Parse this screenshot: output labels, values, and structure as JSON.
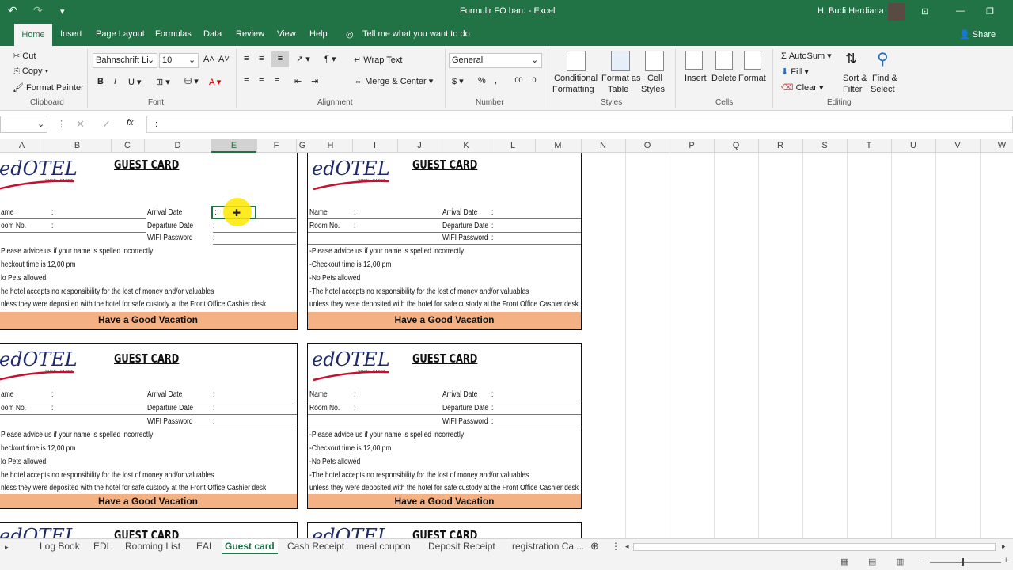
{
  "titlebar": {
    "doc_title": "Formulir FO baru  -  Excel",
    "user": "H. Budi Herdiana"
  },
  "menu": {
    "tabs": [
      "Home",
      "Insert",
      "Page Layout",
      "Formulas",
      "Data",
      "Review",
      "View",
      "Help"
    ],
    "tell_me": "Tell me what you want to do",
    "share": "Share"
  },
  "ribbon": {
    "clipboard": {
      "cut": "Cut",
      "copy": "Copy",
      "format_painter": "Format Painter",
      "label": "Clipboard"
    },
    "font": {
      "name": "Bahnschrift Li",
      "size": "10",
      "label": "Font"
    },
    "alignment": {
      "wrap": "Wrap Text",
      "merge": "Merge & Center",
      "label": "Alignment"
    },
    "number": {
      "format": "General",
      "label": "Number"
    },
    "styles": {
      "conditional": "Conditional",
      "conditional2": "Formatting",
      "format_as": "Format as",
      "format_as2": "Table",
      "cell": "Cell",
      "cell2": "Styles",
      "label": "Styles"
    },
    "cells": {
      "insert": "Insert",
      "delete": "Delete",
      "format": "Format",
      "label": "Cells"
    },
    "editing": {
      "autosum": "AutoSum",
      "fill": "Fill",
      "clear": "Clear",
      "sort": "Sort &",
      "sort2": "Filter",
      "find": "Find &",
      "find2": "Select",
      "label": "Editing"
    }
  },
  "formula_bar": {
    "fx": "fx",
    "content": ":"
  },
  "columns": [
    "A",
    "B",
    "C",
    "D",
    "E",
    "F",
    "G",
    "H",
    "I",
    "J",
    "K",
    "L",
    "M",
    "N",
    "O",
    "P",
    "Q",
    "R",
    "S",
    "T",
    "U",
    "V",
    "W"
  ],
  "card": {
    "logo": "edOTEL",
    "logo_sub": "SMKN • FACET",
    "title": "GUEST CARD",
    "name": "Name",
    "room": "Room No.",
    "colon": ":",
    "arrival": "Arrival Date",
    "departure": "Departure Date",
    "wifi": "WIFI Password",
    "note1": "-Please advice us if your name is spelled incorrectly",
    "note2": "-Checkout time is 12,00 pm",
    "note3": "-No Pets allowed",
    "note4": "-The hotel accepts no responsibility for the lost of money and/or valuables",
    "note5": "unless they were deposited with the hotel for safe custody at the Front Office Cashier desk",
    "footer": "Have a Good Vacation",
    "left_name": "ame",
    "left_room": "oom No.",
    "left_note1": "Please advice us if your name is spelled incorrectly",
    "left_note2": "heckout time is 12,00 pm",
    "left_note3": "lo Pets allowed",
    "left_note4": "he hotel accepts no responsibility for the lost of money and/or valuables",
    "left_note5": "nless they were deposited with the hotel for safe custody at the Front Office Cashier desk"
  },
  "sheets": [
    "Log Book",
    "EDL",
    "Rooming List",
    "EAL",
    "Guest card",
    "Cash Receipt",
    "meal coupon",
    "Deposit Receipt",
    "registration Ca ..."
  ],
  "active_sheet": "Guest card"
}
